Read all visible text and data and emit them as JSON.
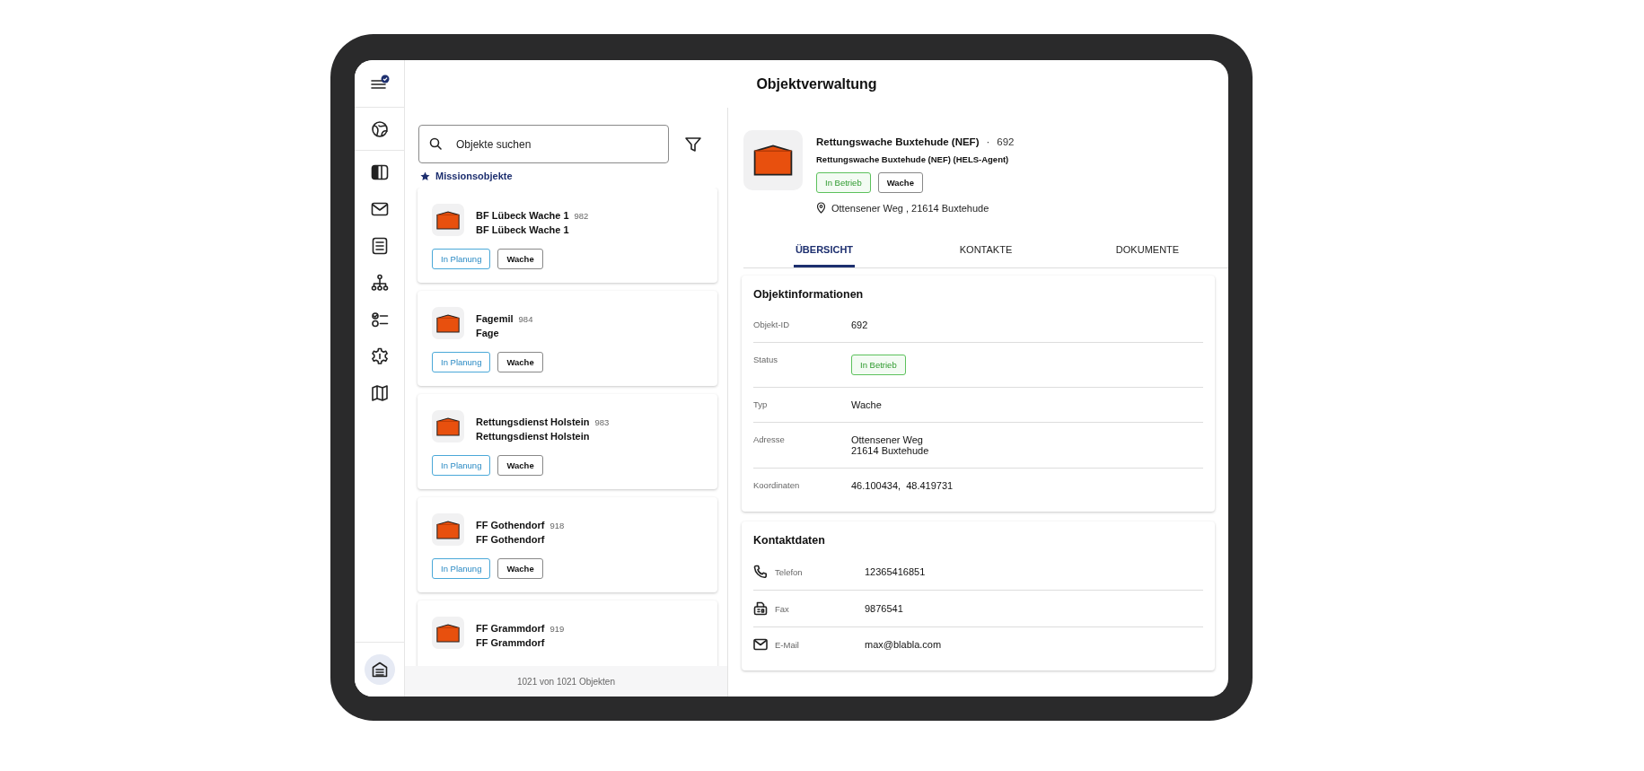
{
  "title": "Objektverwaltung",
  "sidebar": {
    "items": [
      {
        "selected": false
      },
      {
        "selected": false
      },
      {
        "selected": false
      },
      {
        "selected": false
      },
      {
        "selected": false
      },
      {
        "selected": false
      },
      {
        "selected": false
      },
      {
        "selected": false
      }
    ],
    "footer_item": {
      "selected": true
    }
  },
  "list": {
    "search": {
      "placeholder": "Objekte suchen"
    },
    "section_label": "Missionsobjekte",
    "objects": [
      {
        "name": "BF Lübeck Wache 1",
        "id": "982",
        "subtitle": "BF Lübeck Wache 1",
        "status": {
          "text": "In Planung",
          "kind": "planning"
        },
        "type": "Wache"
      },
      {
        "name": "Fagemil",
        "id": "984",
        "subtitle": "Fage",
        "status": {
          "text": "In Planung",
          "kind": "planning"
        },
        "type": "Wache"
      },
      {
        "name": "Rettungsdienst Holstein",
        "id": "983",
        "subtitle": "Rettungsdienst Holstein",
        "status": {
          "text": "In Planung",
          "kind": "planning"
        },
        "type": "Wache"
      },
      {
        "name": "FF Gothendorf",
        "id": "918",
        "subtitle": "FF Gothendorf",
        "status": {
          "text": "In Planung",
          "kind": "planning"
        },
        "type": "Wache"
      },
      {
        "name": "FF Grammdorf",
        "id": "919",
        "subtitle": "FF Grammdorf"
      }
    ],
    "footer": "1021 von 1021 Objekten"
  },
  "detail": {
    "name": "Rettungswache Buxtehude (NEF)",
    "separator": "·",
    "id": "692",
    "subtitle": "Rettungswache Buxtehude (NEF) (HELS-Agent)",
    "status": {
      "text": "In Betrieb",
      "kind": "active"
    },
    "type": "Wache",
    "address": "Ottensener Weg , 21614 Buxtehude",
    "tabs": [
      {
        "label": "ÜBERSICHT",
        "selected": true
      },
      {
        "label": "KONTAKTE",
        "selected": false
      },
      {
        "label": "DOKUMENTE",
        "selected": false
      }
    ],
    "info": {
      "title": "Objektinformationen",
      "rows": [
        {
          "label": "Objekt-ID",
          "lines": [
            "692"
          ]
        },
        {
          "label": "Status",
          "badge": {
            "text": "In Betrieb",
            "kind": "active"
          }
        },
        {
          "label": "Typ",
          "lines": [
            "Wache"
          ]
        },
        {
          "label": "Adresse",
          "lines": [
            "Ottensener Weg",
            "21614 Buxtehude"
          ]
        },
        {
          "label": "Koordinaten",
          "lines": [
            "46.100434,  48.419731"
          ]
        }
      ]
    },
    "contacts": {
      "title": "Kontaktdaten",
      "rows": [
        {
          "kind": "phone",
          "label": "Telefon",
          "value": "12365416851"
        },
        {
          "kind": "fax",
          "label": "Fax",
          "value": "9876541"
        },
        {
          "kind": "email",
          "label": "E-Mail",
          "value": "max@blabla.com"
        }
      ]
    }
  }
}
